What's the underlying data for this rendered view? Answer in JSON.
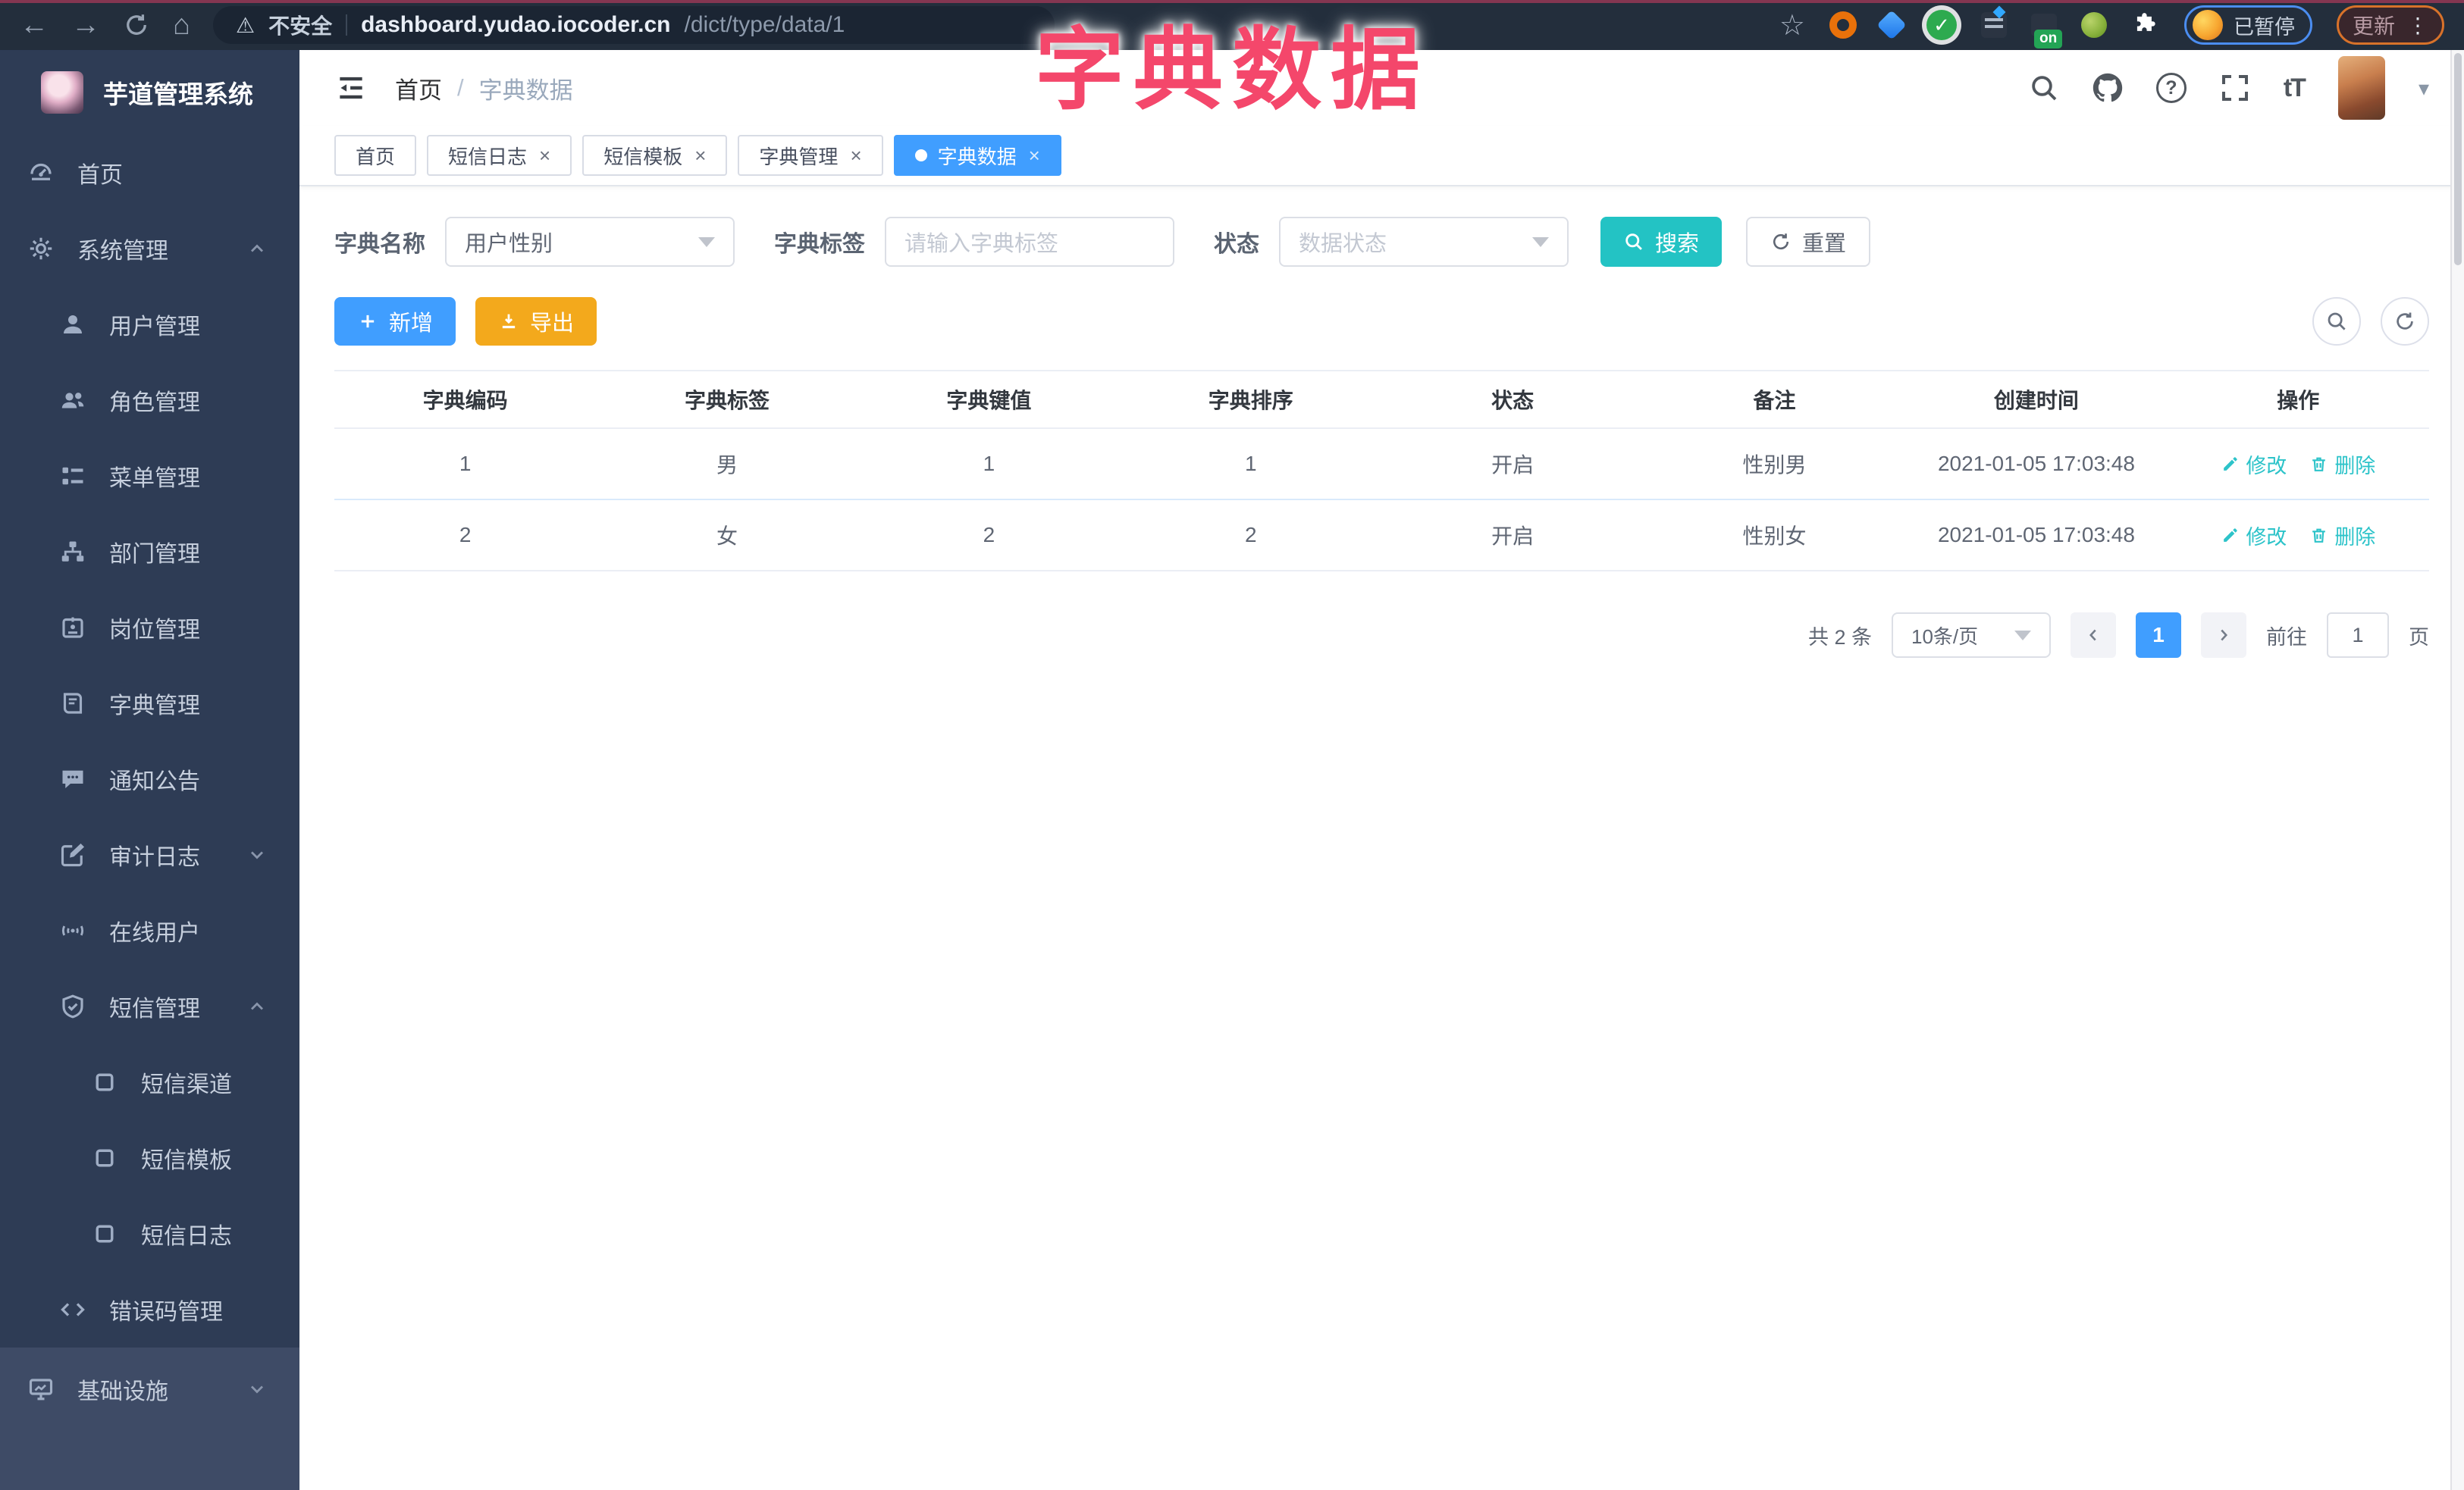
{
  "colors": {
    "primary": "#409eff",
    "teal": "#23c3c4",
    "warning": "#f3a91c",
    "annotation_pink": "#f4476b",
    "sidebar_bg": "#2e3c55"
  },
  "icons": {
    "back": "←",
    "forward": "→",
    "home": "⌂",
    "warning": "⚠",
    "star": "☆",
    "check": "✓",
    "close": "×",
    "caret": "▾",
    "kebab": "⋮",
    "help": "?",
    "fontsize": "tT",
    "divider": "/"
  },
  "browser": {
    "security_label": "不安全",
    "url_domain": "dashboard.yudao.iocoder.cn",
    "url_path": "/dict/type/data/1",
    "extension_badge": "on",
    "paused_label": "已暂停",
    "update_label": "更新"
  },
  "overlay_title": "字典数据",
  "sidebar": {
    "app_title": "芋道管理系统",
    "menu": [
      {
        "label": "首页",
        "icon": "dashboard-icon",
        "level": 1
      },
      {
        "label": "系统管理",
        "icon": "gear-icon",
        "level": 1,
        "expand": "up"
      },
      {
        "label": "用户管理",
        "icon": "user-icon",
        "level": 2
      },
      {
        "label": "角色管理",
        "icon": "users-icon",
        "level": 2
      },
      {
        "label": "菜单管理",
        "icon": "menu-list-icon",
        "level": 2
      },
      {
        "label": "部门管理",
        "icon": "org-tree-icon",
        "level": 2
      },
      {
        "label": "岗位管理",
        "icon": "badge-icon",
        "level": 2
      },
      {
        "label": "字典管理",
        "icon": "book-icon",
        "level": 2
      },
      {
        "label": "通知公告",
        "icon": "bubble-icon",
        "level": 2
      },
      {
        "label": "审计日志",
        "icon": "edit-square-icon",
        "level": 2,
        "expand": "down"
      },
      {
        "label": "在线用户",
        "icon": "online-icon",
        "level": 2
      },
      {
        "label": "短信管理",
        "icon": "shield-check-icon",
        "level": 2,
        "expand": "up"
      },
      {
        "label": "短信渠道",
        "icon": "square-icon",
        "level": 3
      },
      {
        "label": "短信模板",
        "icon": "square-icon",
        "level": 3
      },
      {
        "label": "短信日志",
        "icon": "square-icon",
        "level": 3
      },
      {
        "label": "错误码管理",
        "icon": "code-icon",
        "level": 2
      },
      {
        "label": "基础设施",
        "icon": "monitor-icon",
        "level": 1,
        "expand": "down",
        "highlight": true
      }
    ]
  },
  "topbar": {
    "breadcrumb": [
      "首页",
      "字典数据"
    ]
  },
  "tabs": [
    {
      "label": "首页",
      "closable": false,
      "active": false
    },
    {
      "label": "短信日志",
      "closable": true,
      "active": false
    },
    {
      "label": "短信模板",
      "closable": true,
      "active": false
    },
    {
      "label": "字典管理",
      "closable": true,
      "active": false
    },
    {
      "label": "字典数据",
      "closable": true,
      "active": true
    }
  ],
  "filters": {
    "name_label": "字典名称",
    "name_value": "用户性别",
    "tag_label": "字典标签",
    "tag_placeholder": "请输入字典标签",
    "status_label": "状态",
    "status_placeholder": "数据状态",
    "search_label": "搜索",
    "reset_label": "重置"
  },
  "toolbar": {
    "add_label": "新增",
    "export_label": "导出"
  },
  "table": {
    "columns": [
      "字典编码",
      "字典标签",
      "字典键值",
      "字典排序",
      "状态",
      "备注",
      "创建时间",
      "操作"
    ],
    "rows": [
      {
        "code": "1",
        "label": "男",
        "value": "1",
        "sort": "1",
        "status": "开启",
        "remark": "性别男",
        "created": "2021-01-05 17:03:48"
      },
      {
        "code": "2",
        "label": "女",
        "value": "2",
        "sort": "2",
        "status": "开启",
        "remark": "性别女",
        "created": "2021-01-05 17:03:48"
      }
    ],
    "edit_label": "修改",
    "delete_label": "删除"
  },
  "pagination": {
    "total": "共 2 条",
    "page_size": "10条/页",
    "current_page": "1",
    "goto_label": "前往",
    "goto_value": "1",
    "page_suffix": "页"
  }
}
